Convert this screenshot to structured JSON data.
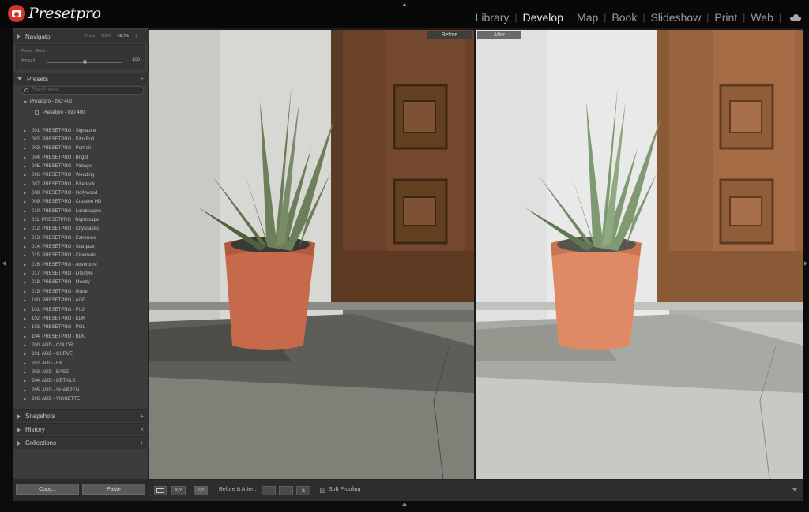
{
  "app": {
    "name": "Presetpro",
    "modules": [
      "Library",
      "Develop",
      "Map",
      "Book",
      "Slideshow",
      "Print",
      "Web"
    ],
    "active_module": "Develop"
  },
  "navigator": {
    "title": "Navigator",
    "zoom_options": [
      "FILL ‡",
      "100%",
      "66.7%",
      "‡"
    ],
    "selected_zoom": "66.7%"
  },
  "preset_info": {
    "preset_label": "Preset : None",
    "amount_label": "Amount",
    "amount_value": "100",
    "amount_level": 0.5
  },
  "presets": {
    "title": "Presets",
    "add_symbol": "+",
    "search_placeholder": "Filter Presets",
    "folder_name": "Presetpro - ISO 400",
    "folder_item": "Presetpro - ISO 400",
    "items": [
      "001. PRESETPRO - Signature",
      "002. PRESETPRO - Film Roll",
      "003. PRESETPRO - Portrait",
      "004. PRESETPRO - Bright",
      "005. PRESETPRO - Vintage",
      "006. PRESETPRO - Wedding",
      "007. PRESETPRO - Filterlook",
      "008. PRESETPRO - Hollywood",
      "009. PRESETPRO - Creative HD",
      "010. PRESETPRO - Landscapes",
      "011. PRESETPRO - Nightscape",
      "012. PRESETPRO - Cityscapes",
      "013. PRESETPRO - Extremes",
      "014. PRESETPRO - Stargaze",
      "015. PRESETPRO - Cinematic",
      "016. PRESETPRO - Adventure",
      "017. PRESETPRO - Lifestyle",
      "018. PRESETPRO - Moody",
      "019. PRESETPRO - Matte",
      "100. PRESETPRO - AGF",
      "101. PRESETPRO - FUJI",
      "102. PRESETPRO - KDK",
      "103. PRESETPRO - POL",
      "104. PRESETPRO - BLK",
      "200. ADD - COLOR",
      "201. ADD - CURVE",
      "202. ADD - FX",
      "203. ADD - BASE",
      "204. ADD - DETAILS",
      "205. ADD - SHARPEN",
      "206. ADD - VIGNETTE"
    ]
  },
  "sections": {
    "snapshots": {
      "title": "Snapshots",
      "action": "+"
    },
    "history": {
      "title": "History",
      "action": "×"
    },
    "collections": {
      "title": "Collections",
      "action": "+"
    }
  },
  "buttons": {
    "copy": "Copy...",
    "paste": "Paste"
  },
  "view": {
    "before_label": "Before",
    "after_label": "After"
  },
  "toolbar": {
    "view_xy": "X|Y",
    "compare": "Y|Y",
    "before_after_label": "Before & After :",
    "soft_proofing": "Soft Proofing"
  },
  "colors": {
    "brand_red": "#d8342e",
    "panel_bg": "#3c3c3c",
    "active_module": "#e8e8e8"
  }
}
